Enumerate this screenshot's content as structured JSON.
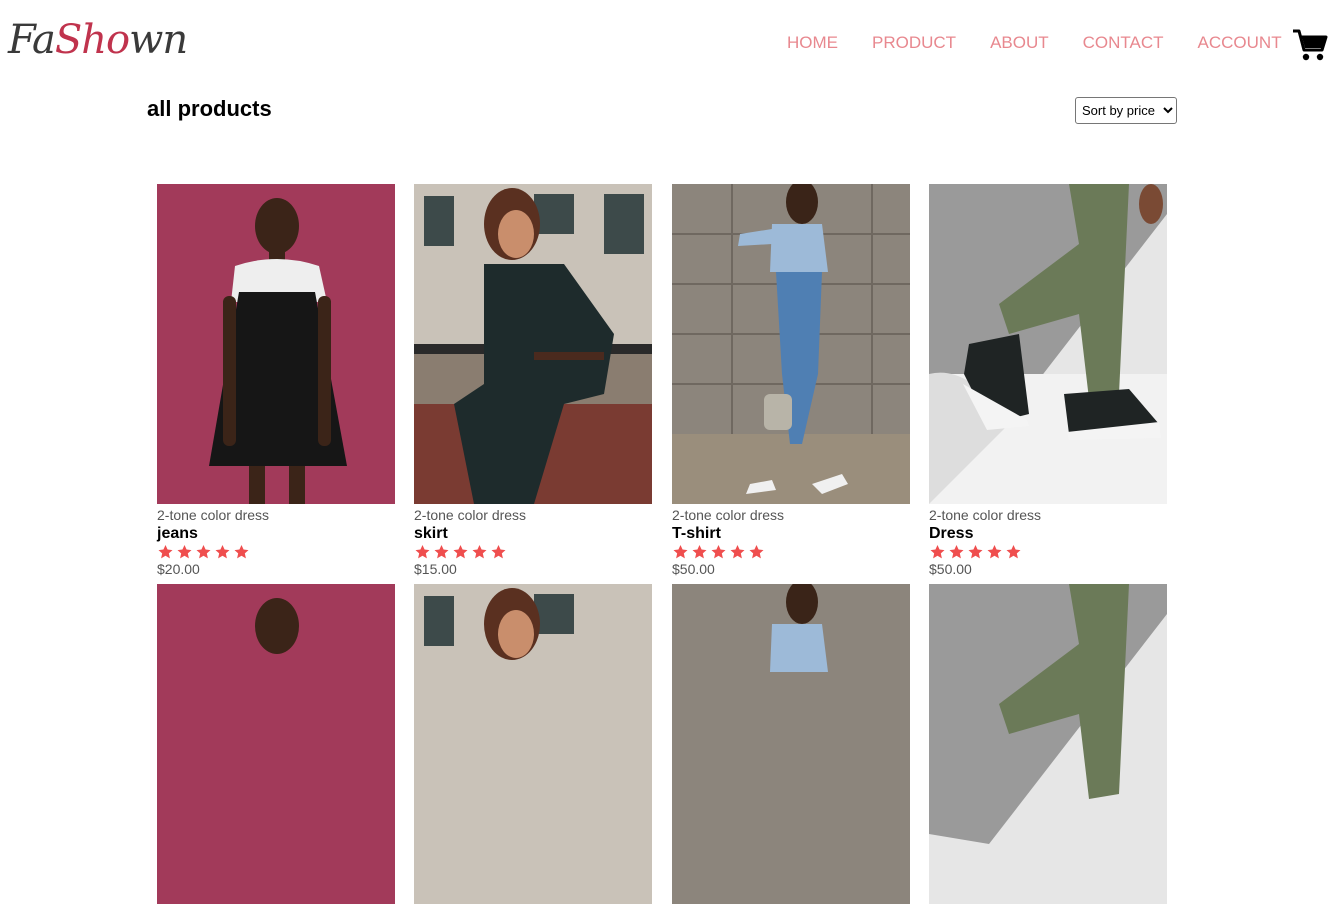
{
  "header": {
    "logo": {
      "part1": "Fa",
      "part2": "Sho",
      "part3": "wn"
    },
    "nav": [
      "HOME",
      "PRODUCT",
      "ABOUT",
      "CONTACT",
      "ACCOUNT"
    ],
    "cart_icon": "shopping-cart-icon"
  },
  "page": {
    "title": "all products",
    "sort": {
      "selected": "Sort by price"
    }
  },
  "colors": {
    "nav": "#e8888f",
    "star": "#ef4e4e",
    "logo_accent": "#c0334d"
  },
  "products": [
    {
      "subtitle": "2-tone color dress",
      "name": "jeans",
      "rating": 5,
      "price": "$20.00"
    },
    {
      "subtitle": "2-tone color dress",
      "name": "skirt",
      "rating": 5,
      "price": "$15.00"
    },
    {
      "subtitle": "2-tone color dress",
      "name": "T-shirt",
      "rating": 5,
      "price": "$50.00"
    },
    {
      "subtitle": "2-tone color dress",
      "name": "Dress",
      "rating": 5,
      "price": "$50.00"
    }
  ]
}
